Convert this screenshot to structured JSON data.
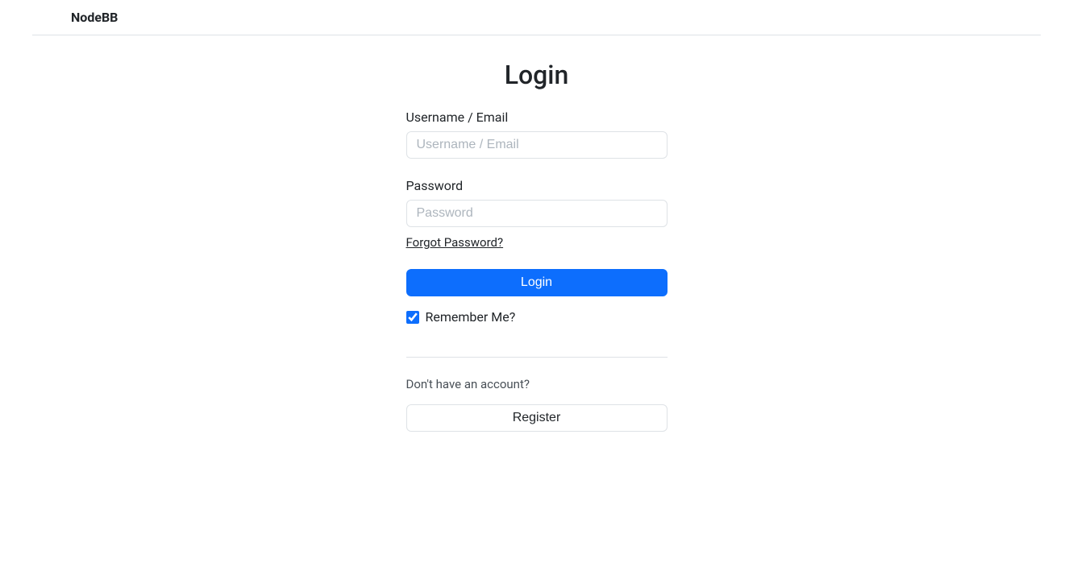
{
  "navbar": {
    "brand": "NodeBB"
  },
  "login": {
    "title": "Login",
    "username_label": "Username / Email",
    "username_placeholder": "Username / Email",
    "password_label": "Password",
    "password_placeholder": "Password",
    "forgot_link": "Forgot Password?",
    "submit_label": "Login",
    "remember_label": "Remember Me?",
    "register_prompt": "Don't have an account?",
    "register_label": "Register"
  }
}
